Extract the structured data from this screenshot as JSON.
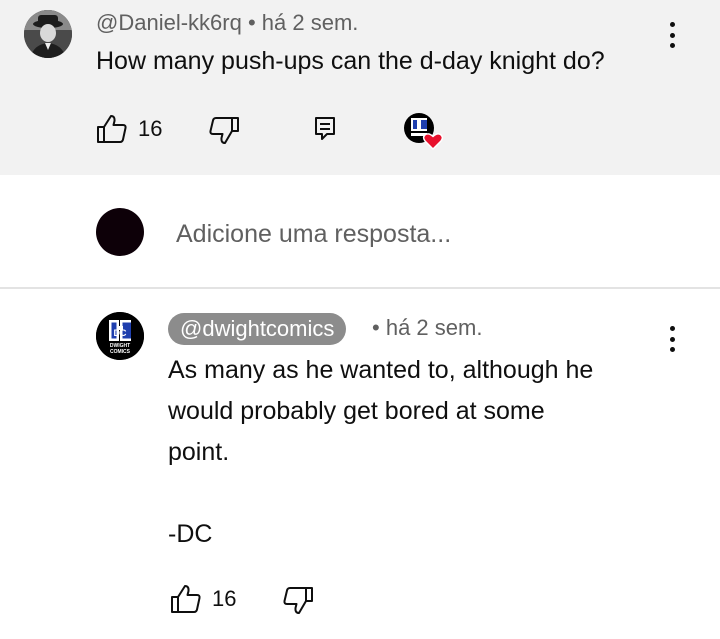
{
  "comment": {
    "author": "@Daniel-kk6rq",
    "time": "há 2 sem.",
    "text": "How many push-ups can the d-day knight do?",
    "likes": "16",
    "avatar_icon": "vintage-man-portrait-icon",
    "actions": {
      "like_icon": "thumbs-up-icon",
      "dislike_icon": "thumbs-down-icon",
      "reply_icon": "reply-comment-icon",
      "creator_heart_icon": "creator-heart-badge-icon"
    }
  },
  "reply_box": {
    "placeholder": "Adicione uma resposta..."
  },
  "reply": {
    "author": "@dwightcomics",
    "time": "há 2 sem.",
    "lines": [
      "As many as he wanted to, although he",
      "would probably get bored at some",
      "point.",
      "",
      "-DC"
    ],
    "likes": "16",
    "avatar_logo": {
      "letters": "DC",
      "caption_1": "DWIGHT",
      "caption_2": "COMICS"
    }
  },
  "colors": {
    "highlight_bg": "#f2f2f2",
    "owner_chip_bg": "#8c8c8c",
    "heart": "#e8112d",
    "logo_blue": "#1f3fae",
    "secondary_text": "#606060"
  }
}
